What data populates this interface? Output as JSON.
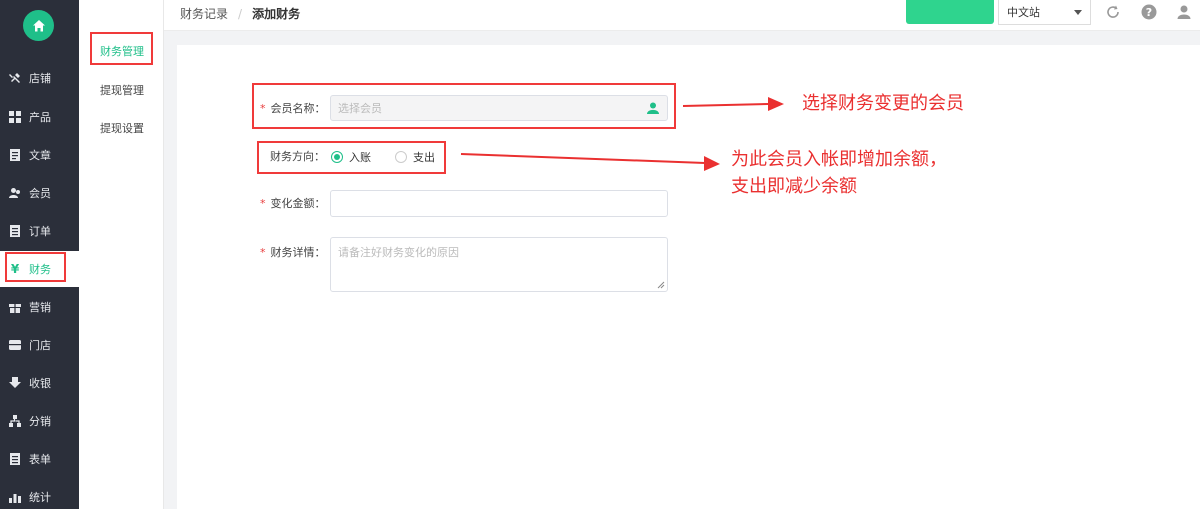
{
  "sidebar": {
    "items": [
      {
        "label": "店铺",
        "icon": "tools-icon"
      },
      {
        "label": "产品",
        "icon": "grid-icon"
      },
      {
        "label": "文章",
        "icon": "document-icon"
      },
      {
        "label": "会员",
        "icon": "users-icon"
      },
      {
        "label": "订单",
        "icon": "order-icon"
      },
      {
        "label": "财务",
        "icon": "yen-icon"
      },
      {
        "label": "营销",
        "icon": "gift-icon"
      },
      {
        "label": "门店",
        "icon": "store-icon"
      },
      {
        "label": "收银",
        "icon": "download-icon"
      },
      {
        "label": "分销",
        "icon": "share-icon"
      },
      {
        "label": "表单",
        "icon": "form-icon"
      },
      {
        "label": "统计",
        "icon": "chart-icon"
      }
    ]
  },
  "subnav": {
    "items": [
      {
        "label": "财务管理"
      },
      {
        "label": "提现管理"
      },
      {
        "label": "提现设置"
      }
    ]
  },
  "header": {
    "breadcrumb_parent": "财务记录",
    "breadcrumb_sep": "/",
    "breadcrumb_current": "添加财务",
    "language": "中文站"
  },
  "form": {
    "required_mark": "*",
    "member_label": "会员名称：",
    "member_placeholder": "选择会员",
    "direction_label": "财务方向：",
    "direction_options": [
      {
        "label": "入账",
        "checked": true
      },
      {
        "label": "支出",
        "checked": false
      }
    ],
    "amount_label": "变化金额：",
    "amount_value": "",
    "detail_label": "财务详情：",
    "detail_placeholder": "请备注好财务变化的原因"
  },
  "annotations": {
    "member_note": "选择财务变更的会员",
    "direction_note_line1": "为此会员入帐即增加余额，",
    "direction_note_line2": "支出即减少余额"
  },
  "colors": {
    "accent": "#1fbf89",
    "sidebar_bg": "#2b2f3a",
    "annotation_red": "#f03a3a"
  }
}
